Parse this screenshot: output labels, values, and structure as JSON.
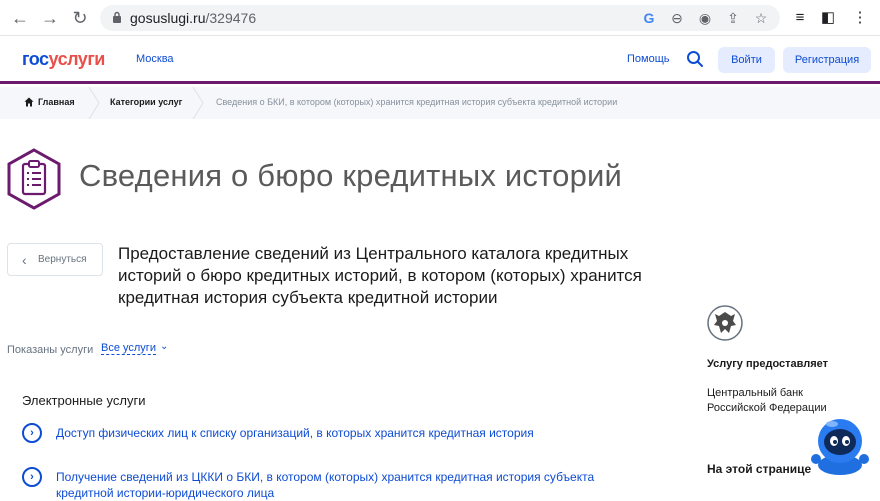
{
  "browser": {
    "url_host": "gosuslugi.ru",
    "url_path": "/329476"
  },
  "header": {
    "logo_part1": "гос",
    "logo_part2": "услуги",
    "city": "Москва",
    "help": "Помощь",
    "login": "Войти",
    "register": "Регистрация"
  },
  "breadcrumbs": {
    "home": "Главная",
    "categories": "Категории услуг",
    "current": "Сведения о БКИ, в котором (которых) хранится кредитная история субъекта кредитной истории"
  },
  "page": {
    "title": "Сведения о бюро кредитных историй",
    "back": "Вернуться",
    "service_title": "Предоставление сведений из Центрального каталога кредитных историй о бюро кредитных историй, в котором (которых) хранится кредитная история субъекта кредитной истории",
    "shown_label": "Показаны услуги",
    "filter_value": "Все услуги",
    "e_services_heading": "Электронные услуги",
    "services": [
      {
        "label": "Доступ физических лиц к списку организаций, в которых хранится кредитная история"
      },
      {
        "label": "Получение сведений из ЦККИ о БКИ, в котором (которых) хранится кредитная история субъекта кредитной истории-юридического лица"
      }
    ]
  },
  "sidebar": {
    "provider_label": "Услугу предоставляет",
    "provider_name": "Центральный банк Российской Федерации",
    "on_this_page": "На этой странице"
  },
  "colors": {
    "brand_blue": "#0d4cd3",
    "brand_red": "#e8504a",
    "accent_purple": "#6b1a6e"
  }
}
